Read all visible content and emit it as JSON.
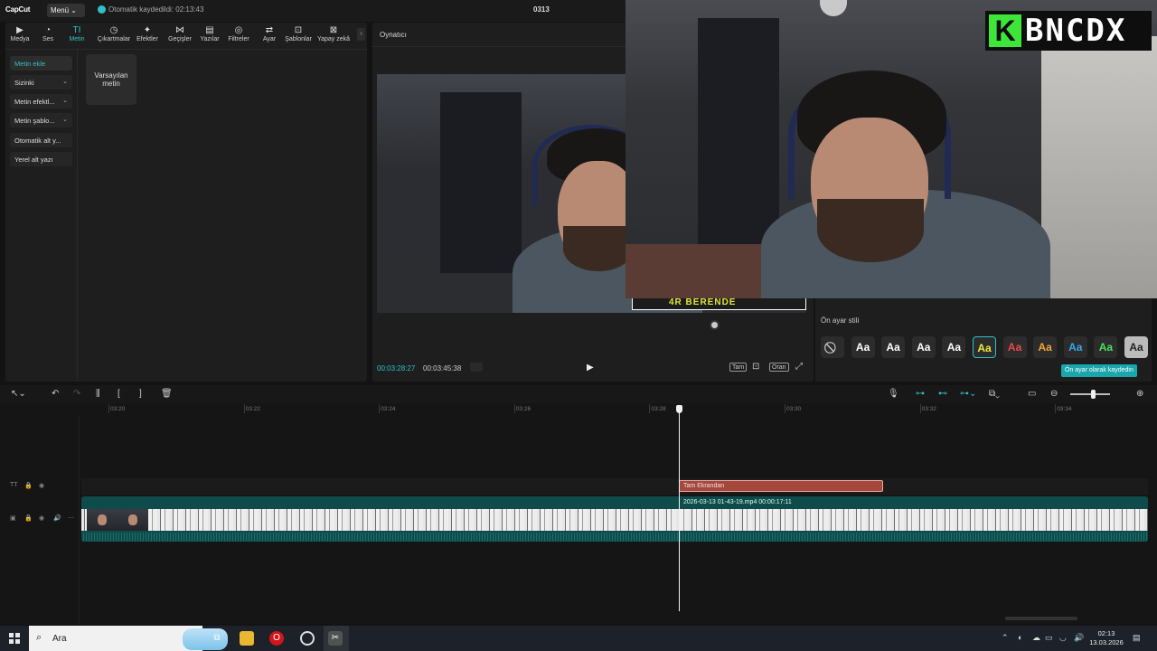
{
  "titlebar": {
    "logo": "CapCut",
    "menu_label": "Menü",
    "autosave": "Otomatik kaydedildi: 02:13:43",
    "project_title": "0313"
  },
  "tools": [
    {
      "label": "Medya",
      "icon": "media-icon",
      "glyph": "▶"
    },
    {
      "label": "Ses",
      "icon": "audio-icon",
      "glyph": "◔"
    },
    {
      "label": "Metin",
      "icon": "text-icon",
      "glyph": "TI"
    },
    {
      "label": "Çıkartmalar",
      "icon": "sticker-icon",
      "glyph": "◷"
    },
    {
      "label": "Efektler",
      "icon": "effects-icon",
      "glyph": "✦"
    },
    {
      "label": "Geçişler",
      "icon": "transitions-icon",
      "glyph": "⋈"
    },
    {
      "label": "Yazılar",
      "icon": "captions-icon",
      "glyph": "▤"
    },
    {
      "label": "Filtreler",
      "icon": "filters-icon",
      "glyph": "◎"
    },
    {
      "label": "Ayar",
      "icon": "adjust-icon",
      "glyph": "⇄"
    },
    {
      "label": "Şablonlar",
      "icon": "templates-icon",
      "glyph": "⊡"
    },
    {
      "label": "Yapay zekâ",
      "icon": "ai-icon",
      "glyph": "⊠"
    }
  ],
  "side_menu": [
    {
      "label": "Metin ekle",
      "chevron": false
    },
    {
      "label": "Sizinki",
      "chevron": true
    },
    {
      "label": "Metin efektl...",
      "chevron": true
    },
    {
      "label": "Metin şablo...",
      "chevron": true
    },
    {
      "label": "Otomatik alt y...",
      "chevron": false
    },
    {
      "label": "Yerel alt yazı",
      "chevron": false
    }
  ],
  "default_text_card": "Varsayılan metin",
  "player": {
    "title": "Oynatıcı",
    "subtitle_text": "4R BERENDE",
    "timecode_current": "00:03:28:27",
    "timecode_total": "00:03:45:38",
    "full_label": "Tam",
    "ratio_label": "Oran"
  },
  "cam_logo": {
    "k": "K",
    "text": "BNCDX"
  },
  "styles": {
    "label": "Ön ayar stili",
    "presets": [
      {
        "kind": "none",
        "text": "⃠",
        "color": "#cccccc"
      },
      {
        "kind": "text",
        "text": "Aa",
        "color": "#ffffff"
      },
      {
        "kind": "text",
        "text": "Aa",
        "color": "#ffffff"
      },
      {
        "kind": "text",
        "text": "Aa",
        "color": "#ffffff"
      },
      {
        "kind": "text",
        "text": "Aa",
        "color": "#ffffff"
      },
      {
        "kind": "text",
        "text": "Aa",
        "color": "#f3e83a",
        "selected": true
      },
      {
        "kind": "text",
        "text": "Aa",
        "color": "#f2474a"
      },
      {
        "kind": "text",
        "text": "Aa",
        "color": "#f2a43a"
      },
      {
        "kind": "text",
        "text": "Aa",
        "color": "#39a8ea"
      },
      {
        "kind": "text",
        "text": "Aa",
        "color": "#47e25c"
      },
      {
        "kind": "text",
        "text": "Aa",
        "color": "#222222"
      }
    ],
    "save_button": "Ön ayar olarak kaydedin"
  },
  "timeline": {
    "ticks": [
      "03:20",
      "03:22",
      "03:24",
      "03:26",
      "03:28",
      "03:30",
      "03:32",
      "03:34"
    ],
    "text_clip": "Tam Ekrandan",
    "video_clip": "2026-03-13 01-43-19.mp4   00:00:17:11"
  },
  "taskbar": {
    "search_placeholder": "Ara",
    "time": "02:13",
    "date": "13.03.2026"
  },
  "colors": {
    "accent": "#2fc0c7",
    "text_clip": "#a4483e",
    "video_track": "#0f4b4b"
  }
}
